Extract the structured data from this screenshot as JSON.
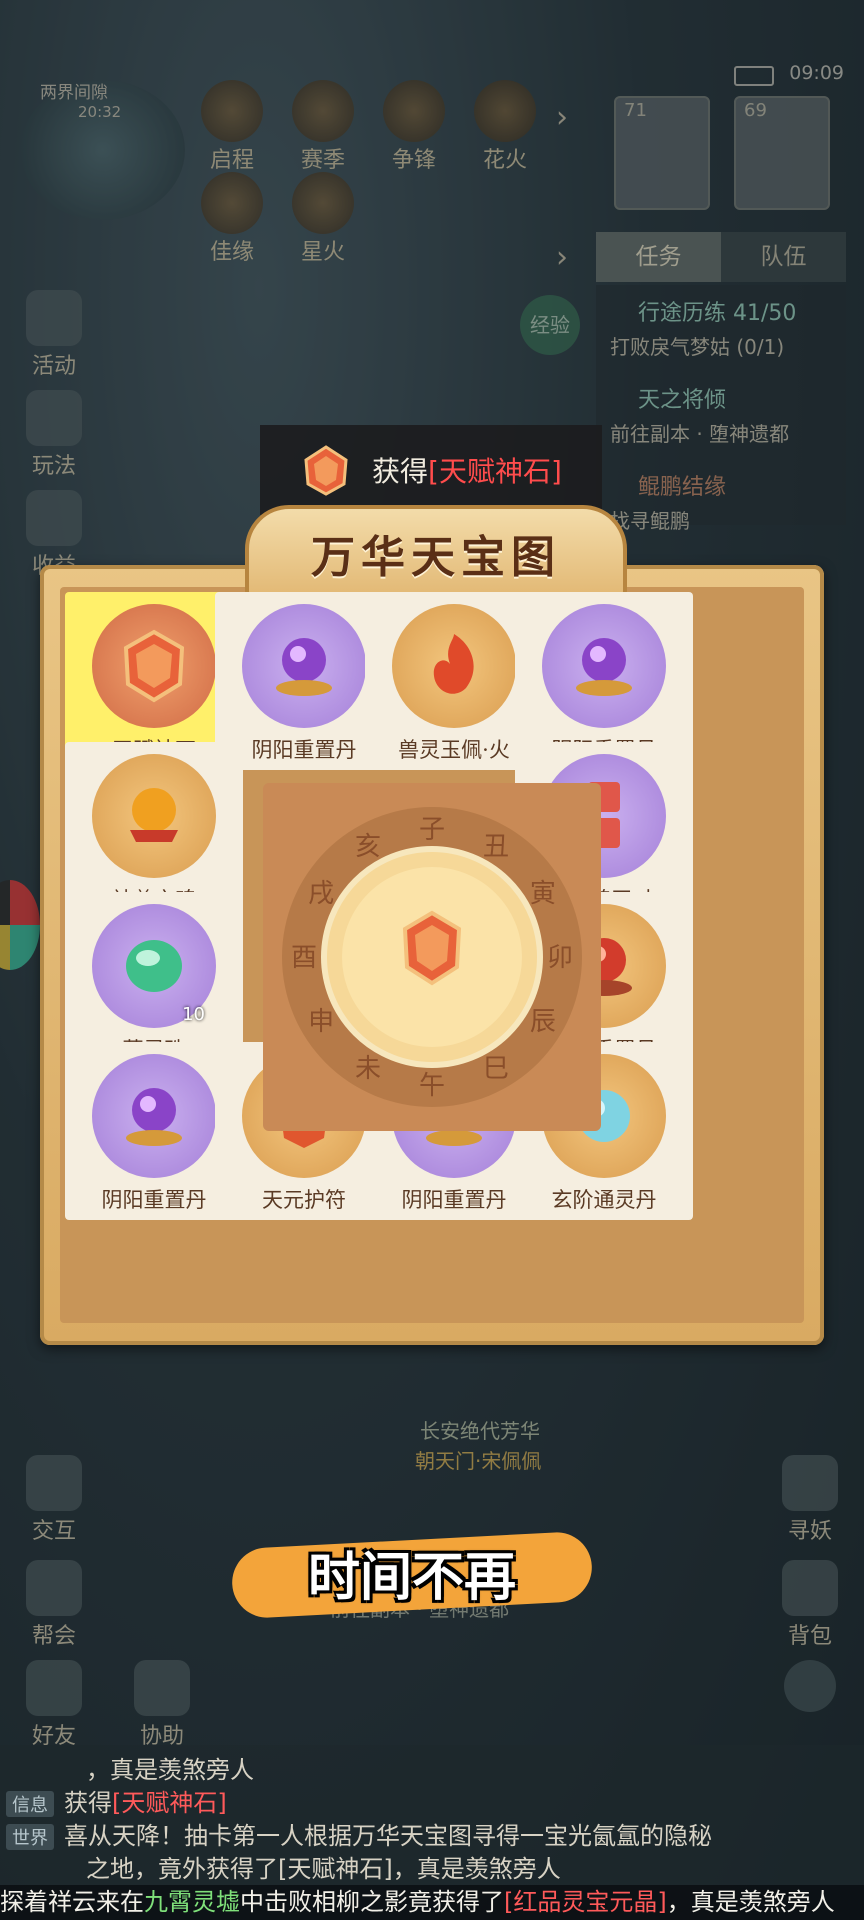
{
  "status": {
    "time": "09:09"
  },
  "minimap": {
    "label": "两界间隙",
    "timer": "20:32"
  },
  "top_icons": [
    {
      "label": "启程",
      "icon": "scroll-icon"
    },
    {
      "label": "赛季",
      "icon": "season-icon"
    },
    {
      "label": "争锋",
      "icon": "swords-icon"
    },
    {
      "label": "花火",
      "icon": "firework-icon"
    },
    {
      "label": "佳缘",
      "icon": "heart-icon"
    },
    {
      "label": "星火",
      "icon": "flame-icon"
    }
  ],
  "portraits": [
    {
      "level": "71"
    },
    {
      "level": "69"
    }
  ],
  "tabs": [
    {
      "label": "任务"
    },
    {
      "label": "队伍"
    }
  ],
  "tasks": [
    {
      "title": "行途历练 41/50",
      "sub": "打败戾气梦姑 (0/1)"
    },
    {
      "title": "天之将倾",
      "sub": "前往副本 · 堕神遗都"
    },
    {
      "title": "鲲鹏结缘",
      "sub": "找寻鲲鹏"
    }
  ],
  "exp_label": "经验",
  "left_icons": [
    {
      "label": "活动"
    },
    {
      "label": "玩法"
    },
    {
      "label": "收益"
    }
  ],
  "bottom_left_icons": [
    {
      "label": "交互"
    },
    {
      "label": "帮会"
    },
    {
      "label": "好友"
    },
    {
      "label": "协助"
    }
  ],
  "bottom_right_icons": [
    {
      "label": "寻妖"
    },
    {
      "label": "背包"
    }
  ],
  "toast": {
    "prefix": "获得",
    "item": "[天赋神石]"
  },
  "board": {
    "title": "万华天宝图",
    "cells": [
      {
        "name": "天赋神石",
        "style": "red",
        "icon": "talent-stone-icon",
        "selected": true
      },
      {
        "name": "阴阳重置丹",
        "style": "purple",
        "icon": "purple-orb-icon"
      },
      {
        "name": "兽灵玉佩·火",
        "style": "gold",
        "icon": "fire-jade-icon"
      },
      {
        "name": "阴阳重置丹",
        "style": "purple",
        "icon": "purple-orb-icon"
      },
      {
        "name": "神兽之魂",
        "style": "gold",
        "icon": "beast-soul-icon"
      },
      {
        "name": "二级魂玉·力",
        "style": "purple",
        "icon": "soul-jade-icon"
      },
      {
        "name": "蕴灵珠",
        "style": "purple",
        "icon": "green-pearl-icon",
        "qty": "10"
      },
      {
        "name": "天元重置丹",
        "style": "gold",
        "icon": "red-orb-icon"
      },
      {
        "name": "阴阳重置丹",
        "style": "purple",
        "icon": "purple-orb-icon"
      },
      {
        "name": "天元护符",
        "style": "gold",
        "icon": "amulet-icon"
      },
      {
        "name": "阴阳重置丹",
        "style": "purple",
        "icon": "purple-orb-icon"
      },
      {
        "name": "玄阶通灵丹",
        "style": "gold",
        "icon": "blue-pill-icon"
      }
    ],
    "zodiac": [
      "子",
      "丑",
      "寅",
      "卯",
      "辰",
      "巳",
      "午",
      "未",
      "申",
      "酉",
      "戌",
      "亥"
    ]
  },
  "subtitle": "时间不再",
  "bg_notice": {
    "line1": "长安绝代芳华",
    "line2": "朝天门·宋佩佩",
    "quest": "前往副本 · 堕神遗都"
  },
  "chat": [
    {
      "tag": "",
      "text": "，真是羡煞旁人"
    },
    {
      "tag": "信息",
      "prefix": "获得",
      "item": "[天赋神石]"
    },
    {
      "tag": "世界",
      "text": "喜从天降！抽卡第一人根据万华天宝图寻得一宝光氤氲的隐秘"
    },
    {
      "tag": "",
      "text": "之地，竟外获得了[天赋神石]，真是羡煞旁人"
    }
  ],
  "ticker": {
    "p1": "探着祥云来在",
    "place": "九霄灵墟",
    "p2": "中击败相柳之影竟获得了",
    "item": "[红品灵宝元晶]",
    "p3": "，真是羡煞旁人"
  },
  "colors": {
    "highlight_red": "#ff4c4c",
    "selected_cell": "#fff06a",
    "subtitle_bg": "#f3a43a"
  }
}
